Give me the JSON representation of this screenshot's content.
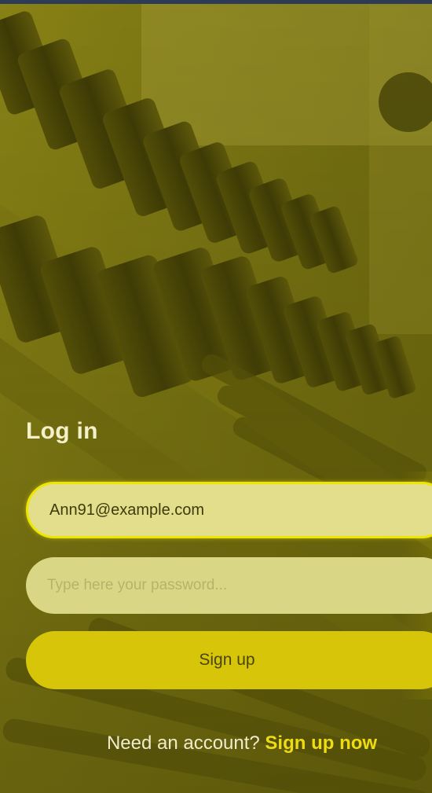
{
  "login": {
    "title": "Log in",
    "email_value": "Ann91@example.com",
    "password_placeholder": "Type here your password...",
    "submit_label": "Sign up"
  },
  "footer": {
    "question": "Need an account?",
    "link": "Sign up now"
  },
  "colors": {
    "accent": "#eedc12",
    "button": "#d7c50a",
    "field": "#e2de8c"
  },
  "background": {
    "icon": "dumbbell-rack-photo"
  }
}
